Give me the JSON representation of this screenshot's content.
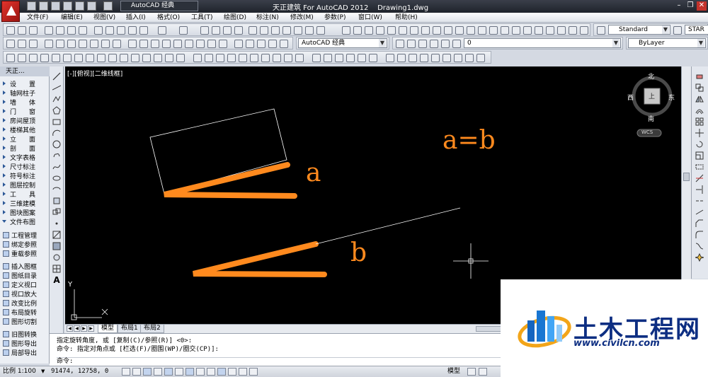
{
  "app": {
    "title": "天正建筑 For AutoCAD 2012    Drawing1.dwg",
    "workspace": "AutoCAD 经典"
  },
  "menu": {
    "items": [
      "文件(F)",
      "编辑(E)",
      "视图(V)",
      "插入(I)",
      "格式(O)",
      "工具(T)",
      "绘图(D)",
      "标注(N)",
      "修改(M)",
      "参数(P)",
      "窗口(W)",
      "帮助(H)"
    ]
  },
  "toolbars": {
    "text_style": "Standard",
    "start_label": "STAR",
    "workspace2": "AutoCAD 经典",
    "layer": "0",
    "bylayer": "ByLayer"
  },
  "left_panel": {
    "title": "天正...",
    "sections": [
      "设　　置",
      "轴网柱子",
      "墙　　体",
      "门　　窗",
      "房间屋顶",
      "楼梯其他",
      "立　　面",
      "剖　　面",
      "文字表格",
      "尺寸标注",
      "符号标注",
      "图层控制",
      "工　　具",
      "三维建模",
      "图块图案",
      "文件布图"
    ],
    "tools": [
      "工程管理",
      "绑定参照",
      "重载参照",
      "插入图框",
      "图纸目录",
      "定义视口",
      "视口放大",
      "改变比例",
      "布局旋转",
      "图形切割",
      "旧图转换",
      "图形导出",
      "局部导出"
    ]
  },
  "canvas": {
    "viewport_label": "[-][俯视][二维线框]",
    "annotations": {
      "a": "a",
      "b": "b",
      "eq": "a=b"
    },
    "colors": {
      "background": "#000000",
      "stroke": "#ff8a1e",
      "line": "#ffffff"
    },
    "ucs": {
      "y": "Y"
    }
  },
  "viewcube": {
    "north": "北",
    "south": "南",
    "east": "东",
    "west": "西",
    "top": "上",
    "wcs": "WCS"
  },
  "layout_tabs": [
    "模型",
    "布局1",
    "布局2"
  ],
  "command": {
    "line1": "指定旋转角度, 或 [复制(C)/参照(R)] <0>:",
    "line2": "命令: 指定对角点或 [栏选(F)/圈围(WP)/圈交(CP)]:",
    "prompt": "命令:"
  },
  "statusbar": {
    "scale": "比例 1:100",
    "coords": "91474, 12758, 0",
    "mode": "模型"
  },
  "watermark": {
    "name": "土木工程网",
    "url": "www.civilcn.com"
  }
}
